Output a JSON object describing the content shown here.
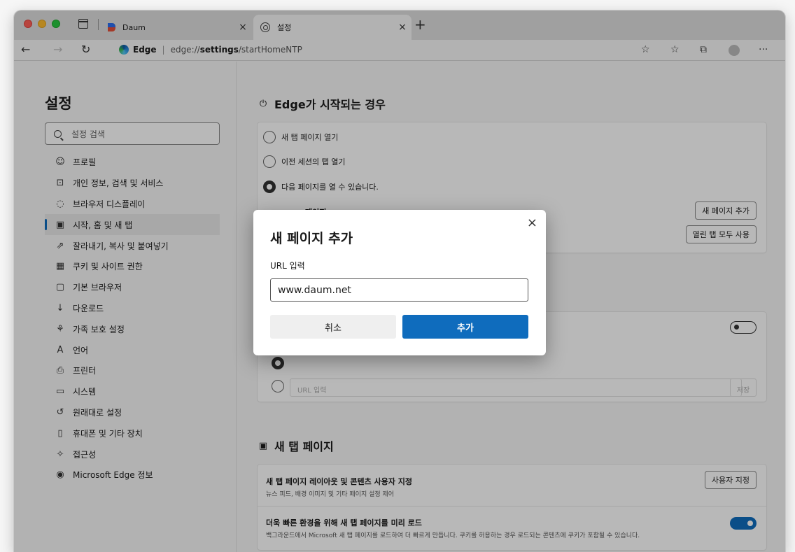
{
  "tabs": [
    {
      "title": "Daum",
      "close": "×"
    },
    {
      "title": "설정",
      "close": "×"
    }
  ],
  "new_tab": "+",
  "address": {
    "brand": "Edge",
    "separator": "|",
    "url_prefix": "edge://",
    "url_bold": "settings",
    "url_rest": "/startHomeNTP"
  },
  "sidebar": {
    "title": "설정",
    "search_placeholder": "설정 검색",
    "items": [
      {
        "icon": "profile-icon",
        "glyph": "☺",
        "label": "프로필"
      },
      {
        "icon": "lock-icon",
        "glyph": "⊡",
        "label": "개인 정보, 검색 및 서비스"
      },
      {
        "icon": "appearance-icon",
        "glyph": "◌",
        "label": "브라우저 디스플레이"
      },
      {
        "icon": "start-home-icon",
        "glyph": "▣",
        "label": "시작, 홈 및 새 탭",
        "active": true
      },
      {
        "icon": "share-icon",
        "glyph": "⇗",
        "label": "잘라내기, 복사 및 붙여넣기"
      },
      {
        "icon": "cookies-icon",
        "glyph": "▦",
        "label": "쿠키 및 사이트 권한"
      },
      {
        "icon": "default-browser-icon",
        "glyph": "▢",
        "label": "기본 브라우저"
      },
      {
        "icon": "download-icon",
        "glyph": "↓",
        "label": "다운로드"
      },
      {
        "icon": "family-icon",
        "glyph": "⚘",
        "label": "가족 보호 설정"
      },
      {
        "icon": "language-icon",
        "glyph": "A",
        "label": "언어"
      },
      {
        "icon": "printer-icon",
        "glyph": "⎙",
        "label": "프린터"
      },
      {
        "icon": "system-icon",
        "glyph": "▭",
        "label": "시스템"
      },
      {
        "icon": "reset-icon",
        "glyph": "↺",
        "label": "원래대로 설정"
      },
      {
        "icon": "phone-icon",
        "glyph": "▯",
        "label": "휴대폰 및 기타 장치"
      },
      {
        "icon": "accessibility-icon",
        "glyph": "✧",
        "label": "접근성"
      },
      {
        "icon": "edge-logo-icon",
        "glyph": "◉",
        "label": "Microsoft Edge 정보"
      }
    ]
  },
  "startup": {
    "title": "Edge가 시작되는 경우",
    "options": [
      {
        "label": "새 탭 페이지 열기",
        "checked": false
      },
      {
        "label": "이전 세션의 탭 열기",
        "checked": false
      },
      {
        "label": "다음 페이지를 열 수 있습니다.",
        "checked": true
      }
    ],
    "pages_label": "페이지",
    "add_page_button": "새 페이지 추가",
    "use_open_tabs_button": "열린 탭 모두 사용"
  },
  "home": {
    "url_placeholder": "URL 입력",
    "save_button": "저장"
  },
  "new_tab_page": {
    "title": "새 탭 페이지",
    "customize_title": "새 탭 페이지 레이아웃 및 콘텐츠 사용자 지정",
    "customize_sub": "뉴스 피드, 배경 이미지 및 기타 페이지 설정 제어",
    "customize_button": "사용자 지정",
    "preload_title": "더욱 빠른 환경을 위해 새 탭 페이지를 미리 로드",
    "preload_sub": "백그라운드에서 Microsoft 새 탭 페이지를 로드하여 더 빠르게 만듭니다. 쿠키를 허용하는 경우 로드되는 콘텐츠에 쿠키가 포함될 수 있습니다.",
    "preload_enabled": true
  },
  "dialog": {
    "title": "새 페이지 추가",
    "close": "×",
    "url_label": "URL 입력",
    "url_value": "www.daum.net",
    "cancel_button": "취소",
    "add_button": "추가"
  },
  "colors": {
    "accent": "#0f6cbd"
  }
}
